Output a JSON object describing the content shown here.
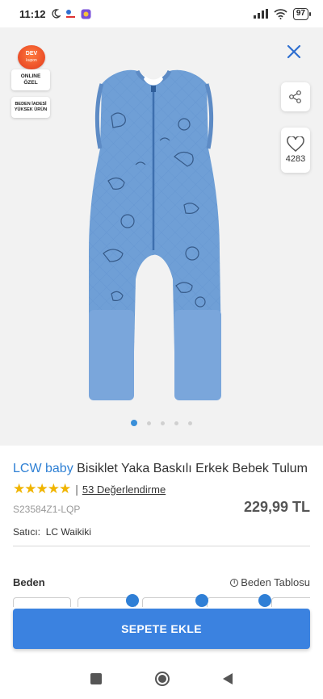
{
  "status_bar": {
    "time": "11:12",
    "battery": "97"
  },
  "badges": {
    "dev": "DEV",
    "dev_sub": "kupon",
    "online_line1": "ONLINE",
    "online_line2": "ÖZEL",
    "iade_line1": "BEDEN İADESİ",
    "iade_line2": "YÜKSEK ÜRÜN"
  },
  "gallery": {
    "favorite_count": "4283",
    "page_count": 5,
    "active_page": 1
  },
  "product": {
    "brand": "LCW baby",
    "title_rest": " Bisiklet Yaka Baskılı Erkek Bebek Tulum",
    "stars": "★★★★★",
    "rating_text": "53 Değerlendirme",
    "price": "229,99 TL",
    "sku": "S23584Z1-LQP",
    "seller_label": "Satıcı:",
    "seller_name": "LC Waikiki"
  },
  "size": {
    "label": "Beden",
    "table_link": "Beden Tablosu"
  },
  "actions": {
    "add_to_cart": "SEPETE EKLE"
  },
  "colors": {
    "accent": "#3b82e0",
    "brand_text": "#2f80d4",
    "product_blue": "#6f9fd6",
    "star": "#f0b400"
  }
}
